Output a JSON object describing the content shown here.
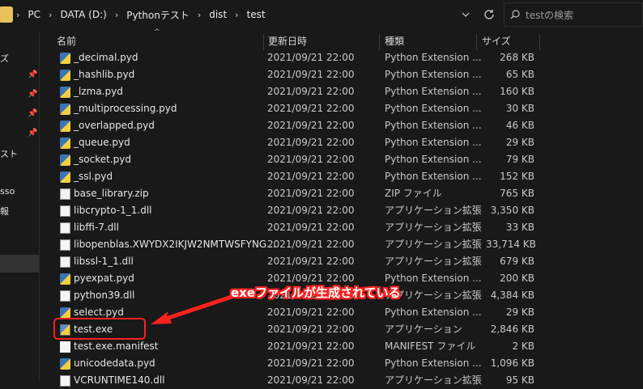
{
  "address": {
    "breadcrumbs": [
      "PC",
      "DATA (D:)",
      "Pythonテスト",
      "dist",
      "test"
    ],
    "separator": "›",
    "dropdown_icon": "chevron-down-icon",
    "refresh_icon": "refresh-icon"
  },
  "search": {
    "placeholder": "testの検索",
    "icon": "search-icon"
  },
  "nav": {
    "items": [
      "ズ",
      "スト",
      "sso",
      "報"
    ]
  },
  "columns": {
    "name": "名前",
    "date": "更新日時",
    "type": "種類",
    "size": "サイズ"
  },
  "files": [
    {
      "name": "_decimal.pyd",
      "date": "2021/09/21 22:00",
      "type": "Python Extension ...",
      "size": "268 KB",
      "icon": "pyd"
    },
    {
      "name": "_hashlib.pyd",
      "date": "2021/09/21 22:00",
      "type": "Python Extension ...",
      "size": "65 KB",
      "icon": "pyd"
    },
    {
      "name": "_lzma.pyd",
      "date": "2021/09/21 22:00",
      "type": "Python Extension ...",
      "size": "160 KB",
      "icon": "pyd"
    },
    {
      "name": "_multiprocessing.pyd",
      "date": "2021/09/21 22:00",
      "type": "Python Extension ...",
      "size": "30 KB",
      "icon": "pyd"
    },
    {
      "name": "_overlapped.pyd",
      "date": "2021/09/21 22:00",
      "type": "Python Extension ...",
      "size": "46 KB",
      "icon": "pyd"
    },
    {
      "name": "_queue.pyd",
      "date": "2021/09/21 22:00",
      "type": "Python Extension ...",
      "size": "29 KB",
      "icon": "pyd"
    },
    {
      "name": "_socket.pyd",
      "date": "2021/09/21 22:00",
      "type": "Python Extension ...",
      "size": "79 KB",
      "icon": "pyd"
    },
    {
      "name": "_ssl.pyd",
      "date": "2021/09/21 22:00",
      "type": "Python Extension ...",
      "size": "152 KB",
      "icon": "pyd"
    },
    {
      "name": "base_library.zip",
      "date": "2021/09/21 22:00",
      "type": "ZIP ファイル",
      "size": "765 KB",
      "icon": "zip"
    },
    {
      "name": "libcrypto-1_1.dll",
      "date": "2021/09/21 22:00",
      "type": "アプリケーション拡張",
      "size": "3,350 KB",
      "icon": "dll"
    },
    {
      "name": "libffi-7.dll",
      "date": "2021/09/21 22:00",
      "type": "アプリケーション拡張",
      "size": "33 KB",
      "icon": "dll"
    },
    {
      "name": "libopenblas.XWYDX2IKJW2NMTWSFYNG...",
      "date": "2021/09/21 22:00",
      "type": "アプリケーション拡張",
      "size": "33,714 KB",
      "icon": "dll"
    },
    {
      "name": "libssl-1_1.dll",
      "date": "2021/09/21 22:00",
      "type": "アプリケーション拡張",
      "size": "679 KB",
      "icon": "dll"
    },
    {
      "name": "pyexpat.pyd",
      "date": "2021/09/21 22:00",
      "type": "Python Extension ...",
      "size": "200 KB",
      "icon": "pyd"
    },
    {
      "name": "python39.dll",
      "date": "2021/09/21 22:00",
      "type": "アプリケーション拡張",
      "size": "4,384 KB",
      "icon": "dll"
    },
    {
      "name": "select.pyd",
      "date": "2021/09/21 22:00",
      "type": "Python Extension ...",
      "size": "29 KB",
      "icon": "pyd"
    },
    {
      "name": "test.exe",
      "date": "2021/09/21 22:00",
      "type": "アプリケーション",
      "size": "2,846 KB",
      "icon": "exe"
    },
    {
      "name": "test.exe.manifest",
      "date": "2021/09/21 22:00",
      "type": "MANIFEST ファイル",
      "size": "2 KB",
      "icon": "file"
    },
    {
      "name": "unicodedata.pyd",
      "date": "2021/09/21 22:00",
      "type": "Python Extension ...",
      "size": "1,096 KB",
      "icon": "pyd"
    },
    {
      "name": "VCRUNTIME140.dll",
      "date": "2021/09/21 22:00",
      "type": "アプリケーション拡張",
      "size": "95 KB",
      "icon": "dll"
    }
  ],
  "annotation": {
    "text": "exeファイルが生成されている",
    "color": "#ff2020"
  }
}
